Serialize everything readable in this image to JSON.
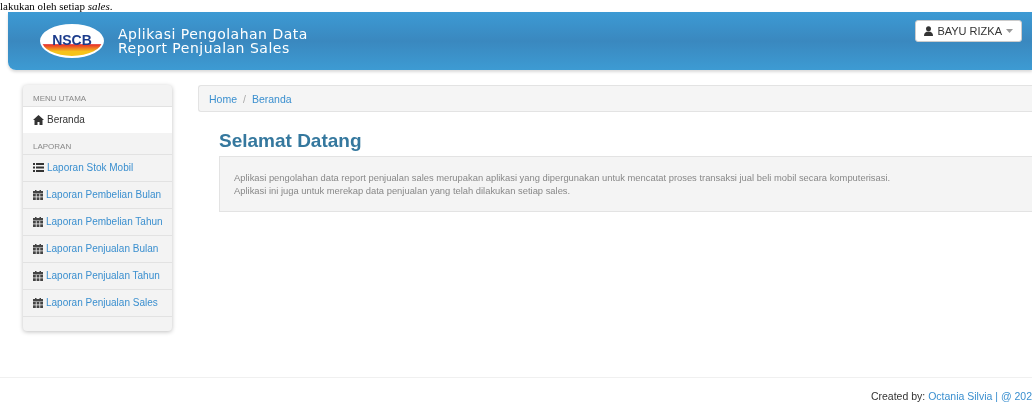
{
  "document_text": "lakukan oleh setiap *sales*.",
  "header": {
    "logo": "NSCB",
    "title_lines": [
      "Aplikasi Pengolahan Data",
      "Report Penjualan Sales"
    ],
    "user_button": "BAYU RIZKA"
  },
  "sidebar": {
    "sections": [
      {
        "heading": "MENU UTAMA",
        "items": [
          {
            "label": "Beranda",
            "kind": "home",
            "selected": true
          }
        ]
      },
      {
        "heading": "LAPORAN",
        "items": [
          {
            "label": "Laporan Stok Mobil",
            "kind": "list",
            "selected": false
          },
          {
            "label": "Laporan Pembelian Bulan",
            "kind": "calendar",
            "selected": false
          },
          {
            "label": "Laporan Pembelian Tahun",
            "kind": "calendar",
            "selected": false
          },
          {
            "label": "Laporan Penjualan Bulan",
            "kind": "calendar",
            "selected": false
          },
          {
            "label": "Laporan Penjualan Tahun",
            "kind": "calendar",
            "selected": false
          },
          {
            "label": "Laporan Penjualan Sales",
            "kind": "calendar",
            "selected": false
          }
        ]
      }
    ]
  },
  "breadcrumb": [
    "Home",
    "Beranda"
  ],
  "breadcrumb_separator": "/",
  "heading": "Selamat Datang",
  "welcome_lines": [
    "Aplikasi pengolahan data report penjualan sales merupakan aplikasi yang dipergunakan untuk mencatat proses transaksi jual beli mobil secara komputerisasi.",
    "Aplikasi ini juga untuk merekap data penjualan yang telah dilakukan setiap sales."
  ],
  "footer": {
    "label": "Created by:",
    "link": "Octania Silvia | @ 202"
  }
}
